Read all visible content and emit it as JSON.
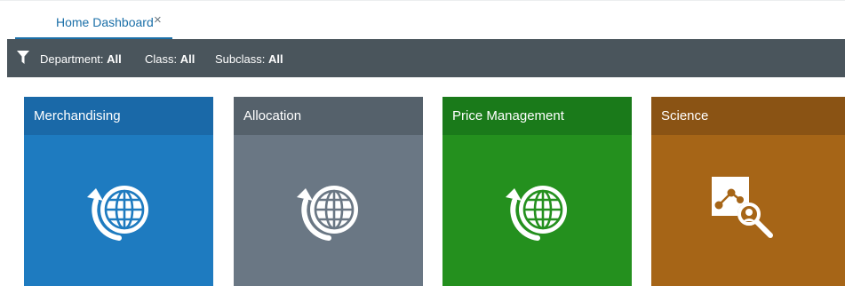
{
  "tabs": [
    {
      "label": "Home Dashboard",
      "close_glyph": "×",
      "active": true
    }
  ],
  "filters": [
    {
      "label": "Department:",
      "value": "All"
    },
    {
      "label": "Class:",
      "value": "All"
    },
    {
      "label": "Subclass:",
      "value": "All"
    }
  ],
  "filter_icon": "funnel-icon",
  "tiles": [
    {
      "title": "Merchandising",
      "icon": "globe-icon",
      "header_color": "#1a69a8",
      "body_color": "#1e7bc0"
    },
    {
      "title": "Allocation",
      "icon": "globe-icon",
      "header_color": "#55616b",
      "body_color": "#6a7784"
    },
    {
      "title": "Price Management",
      "icon": "globe-icon",
      "header_color": "#1a7a1a",
      "body_color": "#24901e"
    },
    {
      "title": "Science",
      "icon": "analytics-search-icon",
      "header_color": "#8a5314",
      "body_color": "#a66517"
    }
  ]
}
